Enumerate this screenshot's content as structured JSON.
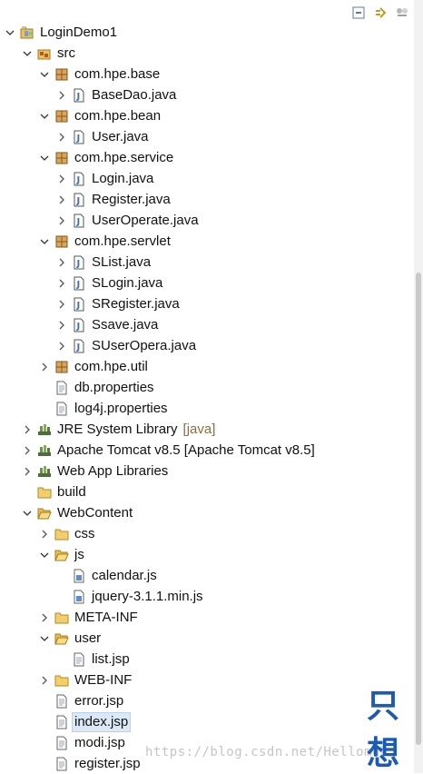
{
  "toolbar": {
    "collapse_icon": "collapse-all-icon",
    "link_icon": "link-with-editor-icon",
    "menu_icon": "view-menu-icon"
  },
  "tree": [
    {
      "name": "project-node",
      "label": "LoginDemo1",
      "level": 0,
      "expand": "down",
      "icon": "project"
    },
    {
      "name": "src-folder-node",
      "label": "src",
      "level": 1,
      "expand": "down",
      "icon": "srcfolder"
    },
    {
      "name": "package-node",
      "label": "com.hpe.base",
      "level": 2,
      "expand": "down",
      "icon": "package"
    },
    {
      "name": "java-file-node",
      "label": "BaseDao.java",
      "level": 3,
      "expand": "right",
      "icon": "java"
    },
    {
      "name": "package-node",
      "label": "com.hpe.bean",
      "level": 2,
      "expand": "down",
      "icon": "package"
    },
    {
      "name": "java-file-node",
      "label": "User.java",
      "level": 3,
      "expand": "right",
      "icon": "java"
    },
    {
      "name": "package-node",
      "label": "com.hpe.service",
      "level": 2,
      "expand": "down",
      "icon": "package"
    },
    {
      "name": "java-file-node",
      "label": "Login.java",
      "level": 3,
      "expand": "right",
      "icon": "java"
    },
    {
      "name": "java-file-node",
      "label": "Register.java",
      "level": 3,
      "expand": "right",
      "icon": "java"
    },
    {
      "name": "java-file-node",
      "label": "UserOperate.java",
      "level": 3,
      "expand": "right",
      "icon": "java"
    },
    {
      "name": "package-node",
      "label": "com.hpe.servlet",
      "level": 2,
      "expand": "down",
      "icon": "package"
    },
    {
      "name": "java-file-node",
      "label": "SList.java",
      "level": 3,
      "expand": "right",
      "icon": "java"
    },
    {
      "name": "java-file-node",
      "label": "SLogin.java",
      "level": 3,
      "expand": "right",
      "icon": "java"
    },
    {
      "name": "java-file-node",
      "label": "SRegister.java",
      "level": 3,
      "expand": "right",
      "icon": "java"
    },
    {
      "name": "java-file-node",
      "label": "Ssave.java",
      "level": 3,
      "expand": "right",
      "icon": "java"
    },
    {
      "name": "java-file-node",
      "label": "SUserOpera.java",
      "level": 3,
      "expand": "right",
      "icon": "java"
    },
    {
      "name": "package-node",
      "label": "com.hpe.util",
      "level": 2,
      "expand": "right",
      "icon": "package"
    },
    {
      "name": "file-node",
      "label": "db.properties",
      "level": 2,
      "expand": "none",
      "icon": "file"
    },
    {
      "name": "file-node",
      "label": "log4j.properties",
      "level": 2,
      "expand": "none",
      "icon": "file"
    },
    {
      "name": "library-node",
      "label": "JRE System Library",
      "suffix": "[java]",
      "level": 1,
      "expand": "right",
      "icon": "library"
    },
    {
      "name": "library-node",
      "label": "Apache Tomcat v8.5 [Apache Tomcat v8.5]",
      "level": 1,
      "expand": "right",
      "icon": "library"
    },
    {
      "name": "library-node",
      "label": "Web App Libraries",
      "level": 1,
      "expand": "right",
      "icon": "library"
    },
    {
      "name": "folder-node",
      "label": "build",
      "level": 1,
      "expand": "none",
      "icon": "folder"
    },
    {
      "name": "folder-node",
      "label": "WebContent",
      "level": 1,
      "expand": "down",
      "icon": "folder-open"
    },
    {
      "name": "folder-node",
      "label": "css",
      "level": 2,
      "expand": "right",
      "icon": "folder"
    },
    {
      "name": "folder-node",
      "label": "js",
      "level": 2,
      "expand": "down",
      "icon": "folder-open"
    },
    {
      "name": "js-file-node",
      "label": "calendar.js",
      "level": 3,
      "expand": "none",
      "icon": "jsfile"
    },
    {
      "name": "js-file-node",
      "label": "jquery-3.1.1.min.js",
      "level": 3,
      "expand": "none",
      "icon": "jsfile"
    },
    {
      "name": "folder-node",
      "label": "META-INF",
      "level": 2,
      "expand": "right",
      "icon": "folder"
    },
    {
      "name": "folder-node",
      "label": "user",
      "level": 2,
      "expand": "down",
      "icon": "folder-open"
    },
    {
      "name": "jsp-file-node",
      "label": "list.jsp",
      "level": 3,
      "expand": "none",
      "icon": "file"
    },
    {
      "name": "folder-node",
      "label": "WEB-INF",
      "level": 2,
      "expand": "right",
      "icon": "folder"
    },
    {
      "name": "jsp-file-node",
      "label": "error.jsp",
      "level": 2,
      "expand": "none",
      "icon": "file"
    },
    {
      "name": "jsp-file-node",
      "label": "index.jsp",
      "level": 2,
      "expand": "none",
      "icon": "file",
      "selected": true
    },
    {
      "name": "jsp-file-node",
      "label": "modi.jsp",
      "level": 2,
      "expand": "none",
      "icon": "file"
    },
    {
      "name": "jsp-file-node",
      "label": "register.jsp",
      "level": 2,
      "expand": "none",
      "icon": "file"
    }
  ],
  "watermark": {
    "url": "https://blog.csdn.net/Hellomdk",
    "logo": "只想"
  }
}
